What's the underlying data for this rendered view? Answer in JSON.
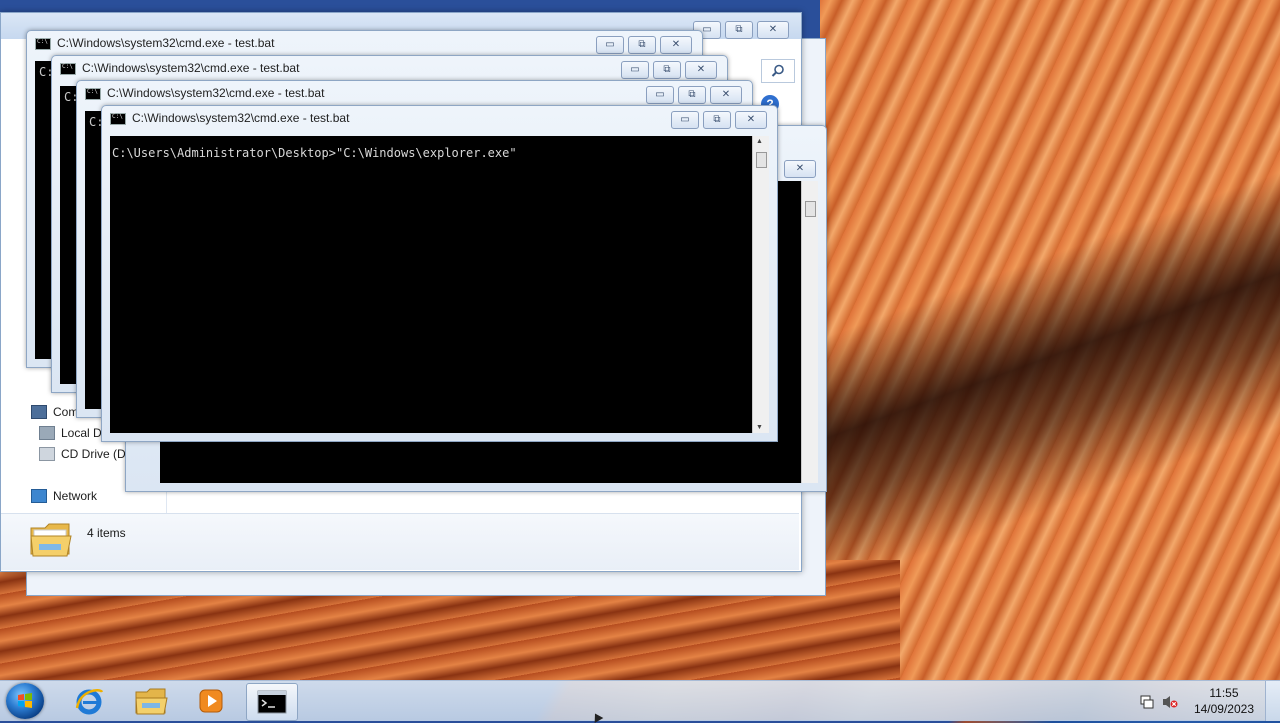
{
  "colors": {
    "console_bg": "#000000",
    "console_text": "#d8d8d8",
    "title_text": "#222222"
  },
  "cmd_windows": [
    {
      "title": "C:\\Windows\\system32\\cmd.exe - test.bat",
      "ghost": "C:"
    },
    {
      "title": "C:\\Windows\\system32\\cmd.exe - test.bat",
      "ghost": "C:"
    },
    {
      "title": "C:\\Windows\\system32\\cmd.exe - test.bat",
      "ghost": "C:"
    },
    {
      "title": "C:\\Windows\\system32\\cmd.exe - test.bat"
    }
  ],
  "console": {
    "line": "C:\\Users\\Administrator\\Desktop>\"C:\\Windows\\explorer.exe\""
  },
  "window_buttons": {
    "minimize": "▭",
    "restore": "⧉",
    "close": "✕"
  },
  "explorer": {
    "nav": [
      {
        "label": "Com",
        "icon": "computer-icon"
      },
      {
        "label": "Local Di",
        "icon": "local-disk-icon"
      },
      {
        "label": "CD Drive (D:)",
        "icon": "cd-drive-icon"
      },
      {
        "label": "Network",
        "icon": "network-icon"
      }
    ],
    "status": {
      "count": "4 items"
    },
    "help": "?"
  },
  "taskbar": {
    "pinned": [
      "internet-explorer-icon",
      "file-explorer-icon",
      "media-player-icon",
      "cmd-icon"
    ],
    "clock": {
      "time": "11:55",
      "date": "14/09/2023"
    }
  }
}
